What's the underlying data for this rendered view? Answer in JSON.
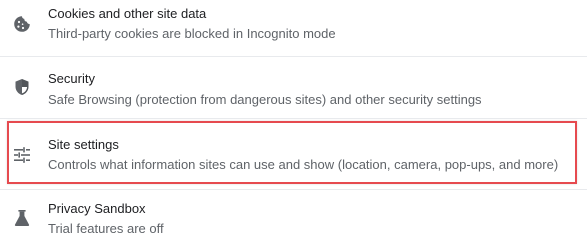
{
  "items": [
    {
      "icon": "cookie-icon",
      "title": "Cookies and other site data",
      "description": "Third-party cookies are blocked in Incognito mode"
    },
    {
      "icon": "shield-icon",
      "title": "Security",
      "description": "Safe Browsing (protection from dangerous sites) and other security settings"
    },
    {
      "icon": "tune-icon",
      "title": "Site settings",
      "description": "Controls what information sites can use and show (location, camera, pop-ups, and more)"
    },
    {
      "icon": "flask-icon",
      "title": "Privacy Sandbox",
      "description": "Trial features are off"
    }
  ],
  "colors": {
    "title": "#202124",
    "description": "#5f6368",
    "icon": "#5f6368",
    "divider": "#e8eaed",
    "highlight_border": "#e64a4f"
  }
}
